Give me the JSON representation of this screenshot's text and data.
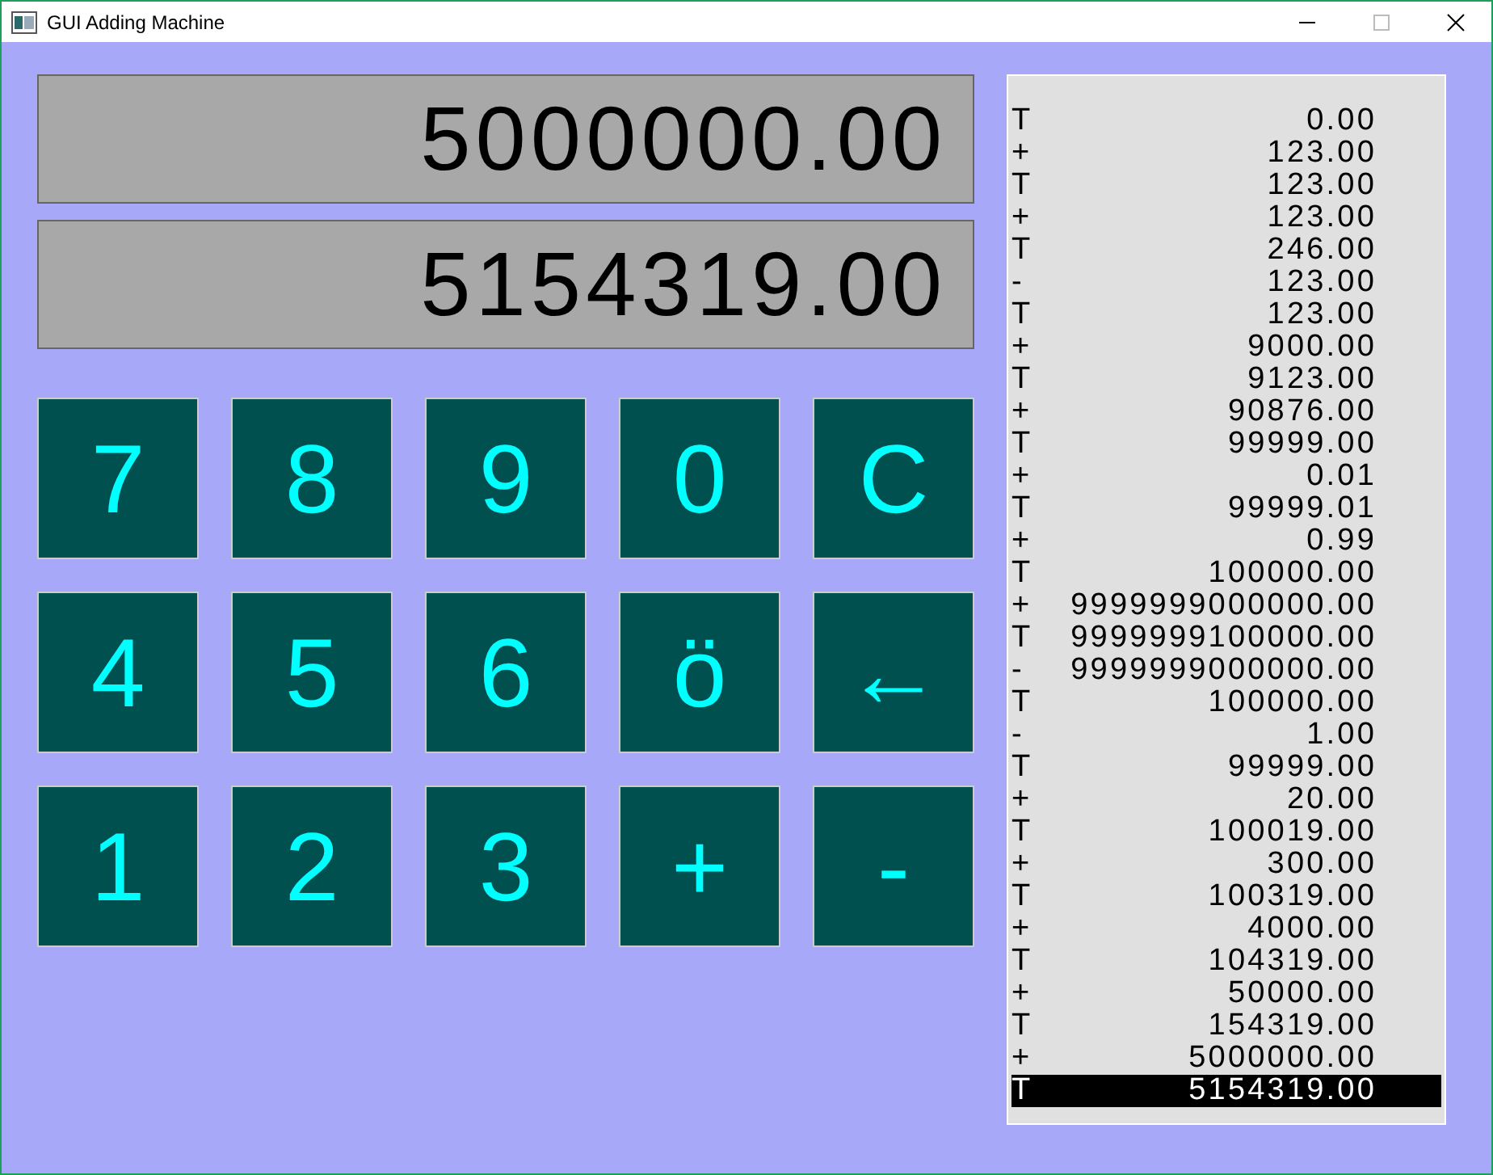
{
  "window": {
    "title": "GUI Adding Machine"
  },
  "displays": [
    "5000000.00",
    "5154319.00"
  ],
  "keys": [
    "7",
    "8",
    "9",
    "0",
    "C",
    "4",
    "5",
    "6",
    "ö",
    "←",
    "1",
    "2",
    "3",
    "+",
    "-"
  ],
  "tape": [
    {
      "op": "T",
      "amount": "0.00",
      "selected": false
    },
    {
      "op": "+",
      "amount": "123.00",
      "selected": false
    },
    {
      "op": "T",
      "amount": "123.00",
      "selected": false
    },
    {
      "op": "+",
      "amount": "123.00",
      "selected": false
    },
    {
      "op": "T",
      "amount": "246.00",
      "selected": false
    },
    {
      "op": "-",
      "amount": "123.00",
      "selected": false
    },
    {
      "op": "T",
      "amount": "123.00",
      "selected": false
    },
    {
      "op": "+",
      "amount": "9000.00",
      "selected": false
    },
    {
      "op": "T",
      "amount": "9123.00",
      "selected": false
    },
    {
      "op": "+",
      "amount": "90876.00",
      "selected": false
    },
    {
      "op": "T",
      "amount": "99999.00",
      "selected": false
    },
    {
      "op": "+",
      "amount": "0.01",
      "selected": false
    },
    {
      "op": "T",
      "amount": "99999.01",
      "selected": false
    },
    {
      "op": "+",
      "amount": "0.99",
      "selected": false
    },
    {
      "op": "T",
      "amount": "100000.00",
      "selected": false
    },
    {
      "op": "+",
      "amount": "9999999000000.00",
      "selected": false
    },
    {
      "op": "T",
      "amount": "9999999100000.00",
      "selected": false
    },
    {
      "op": "-",
      "amount": "9999999000000.00",
      "selected": false
    },
    {
      "op": "T",
      "amount": "100000.00",
      "selected": false
    },
    {
      "op": "-",
      "amount": "1.00",
      "selected": false
    },
    {
      "op": "T",
      "amount": "99999.00",
      "selected": false
    },
    {
      "op": "+",
      "amount": "20.00",
      "selected": false
    },
    {
      "op": "T",
      "amount": "100019.00",
      "selected": false
    },
    {
      "op": "+",
      "amount": "300.00",
      "selected": false
    },
    {
      "op": "T",
      "amount": "100319.00",
      "selected": false
    },
    {
      "op": "+",
      "amount": "4000.00",
      "selected": false
    },
    {
      "op": "T",
      "amount": "104319.00",
      "selected": false
    },
    {
      "op": "+",
      "amount": "50000.00",
      "selected": false
    },
    {
      "op": "T",
      "amount": "154319.00",
      "selected": false
    },
    {
      "op": "+",
      "amount": "5000000.00",
      "selected": false
    },
    {
      "op": "T",
      "amount": "5154319.00",
      "selected": true
    }
  ]
}
